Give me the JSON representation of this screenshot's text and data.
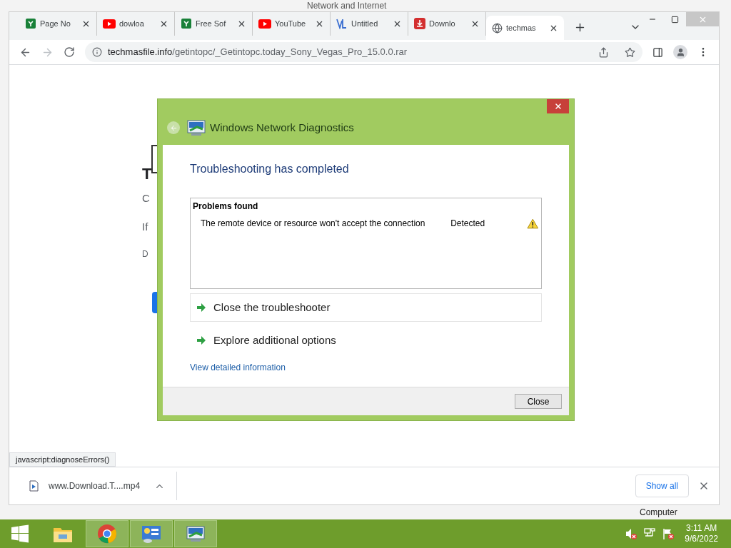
{
  "background_window": {
    "title": "Network and Internet",
    "status_item": "Computer"
  },
  "browser": {
    "tabs": [
      {
        "label": "Page No",
        "kind": "sheet",
        "selected": false
      },
      {
        "label": "dowloa",
        "kind": "video",
        "selected": false
      },
      {
        "label": "Free Sof",
        "kind": "sheet",
        "selected": false
      },
      {
        "label": "YouTube",
        "kind": "video",
        "selected": false
      },
      {
        "label": "Untitled",
        "kind": "letters",
        "selected": false
      },
      {
        "label": "Downlo",
        "kind": "download",
        "selected": false
      },
      {
        "label": "techmas",
        "kind": "globe",
        "selected": true
      }
    ],
    "url_host": "techmasfile.info",
    "url_path": "/getintopc/_Getintopc.today_Sony_Vegas_Pro_15.0.0.rar",
    "page_fragments": [
      {
        "text": "T",
        "kind": "heading"
      },
      {
        "text": "C",
        "kind": "text"
      },
      {
        "text": "If",
        "kind": "text"
      },
      {
        "text": "D",
        "kind": "small"
      }
    ],
    "status_url": "javascript:diagnoseErrors()",
    "downloads": [
      {
        "filename": "www.Download.T....mp4"
      }
    ],
    "show_all": "Show all"
  },
  "dialog": {
    "title": "Windows Network Diagnostics",
    "heading": "Troubleshooting has completed",
    "problems_header": "Problems found",
    "problems": [
      {
        "text": "The remote device or resource won't accept the connection",
        "status": "Detected",
        "kind": "warning"
      }
    ],
    "options": [
      {
        "label": "Close the troubleshooter",
        "highlighted": true
      },
      {
        "label": "Explore additional options",
        "highlighted": false
      }
    ],
    "link": "View detailed information",
    "button": "Close"
  },
  "taskbar": {
    "apps": [
      {
        "kind": "folder",
        "active": false
      },
      {
        "kind": "chrome",
        "active": true
      },
      {
        "kind": "control-panel",
        "active": true
      },
      {
        "kind": "network-diagnostics",
        "active": true
      }
    ],
    "tray": [
      {
        "kind": "speaker",
        "error": true
      },
      {
        "kind": "network",
        "error": false
      },
      {
        "kind": "flag",
        "error": true
      }
    ],
    "time": "3:11 AM",
    "date": "9/6/2022"
  }
}
